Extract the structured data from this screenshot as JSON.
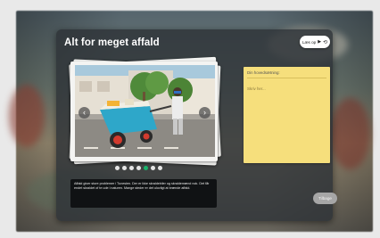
{
  "app": {
    "title": "Alt for meget affald",
    "listen_button": {
      "label": "Læs op",
      "play_icon": "play-icon",
      "loop_icon": "loop-icon"
    },
    "back_button": {
      "label": "Tilbage"
    }
  },
  "slideshow": {
    "current_index": 4,
    "total": 7,
    "caption": "Affald giver store problemer i Tunesien. Der er ikke skraldebiler og skraldemænd nok. Det får endet skraldet of te ude i naturen. Mange steder er det ulovligt at brænde affald."
  },
  "note": {
    "title": "Din hovedsætning:",
    "body": "Skriv her..."
  },
  "colors": {
    "panel": "#2d3237",
    "note": "#f6df7c",
    "active_dot": "#19b36b"
  }
}
